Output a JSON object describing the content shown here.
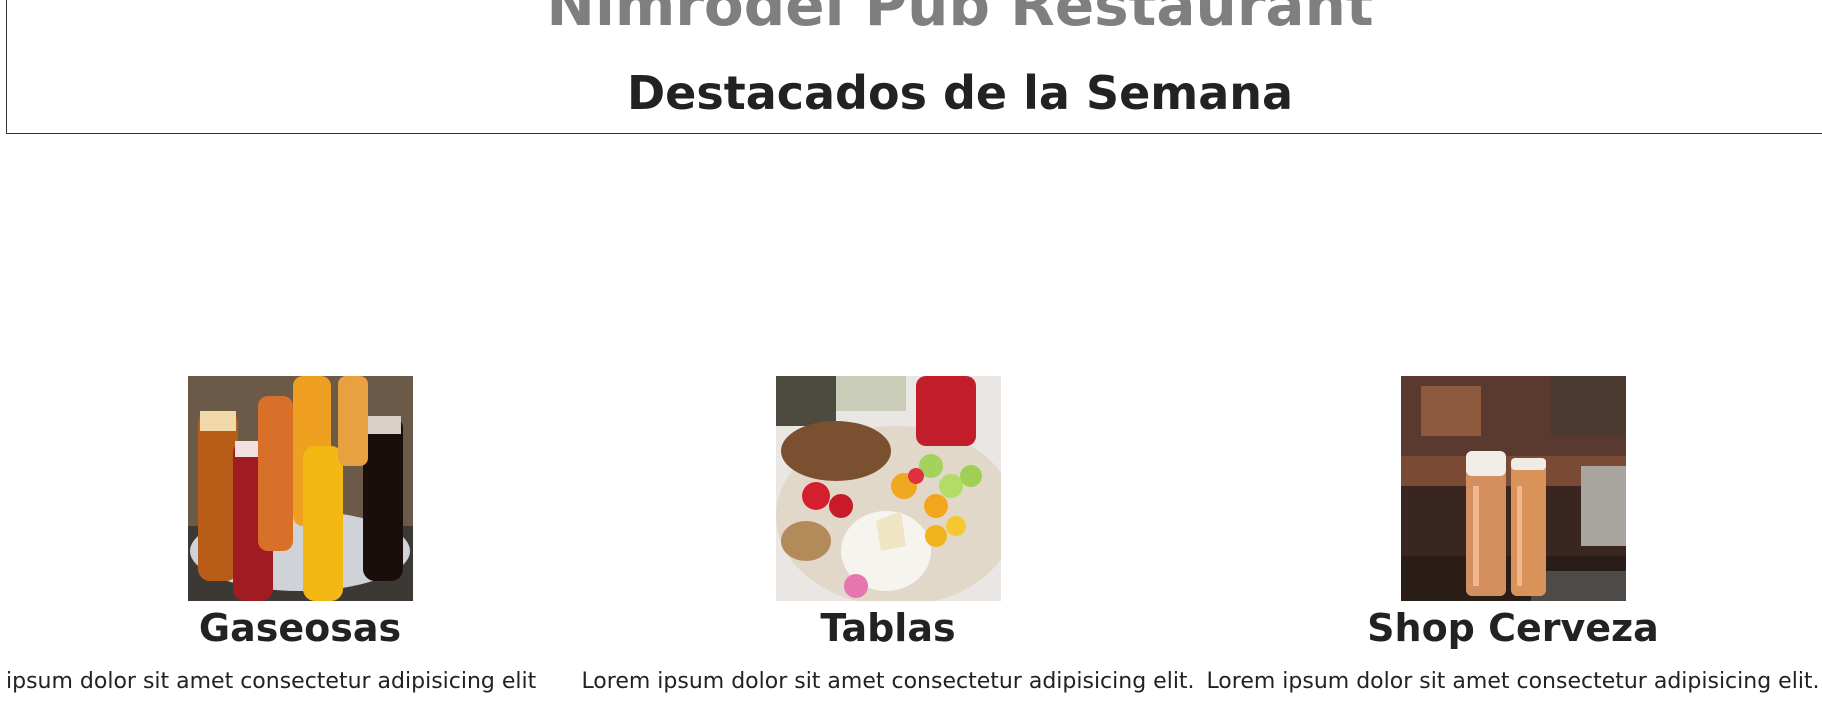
{
  "header": {
    "site_title": "Nimrodel Pub Restaurant",
    "section_title": "Destacados de la Semana"
  },
  "cards": [
    {
      "title": "Gaseosas",
      "text": "ipsum dolor sit amet consectetur adipisicing elit",
      "image": "sodas-photo"
    },
    {
      "title": "Tablas",
      "text": "Lorem ipsum dolor sit amet consectetur adipisicing elit.",
      "image": "cheese-board-photo"
    },
    {
      "title": "Shop Cerveza",
      "text": "Lorem ipsum dolor sit amet consectetur adipisicing elit.",
      "image": "beer-glasses-photo"
    }
  ],
  "colors": {
    "site_title": "#7f7f7f",
    "text": "#222222",
    "border": "#333333"
  }
}
